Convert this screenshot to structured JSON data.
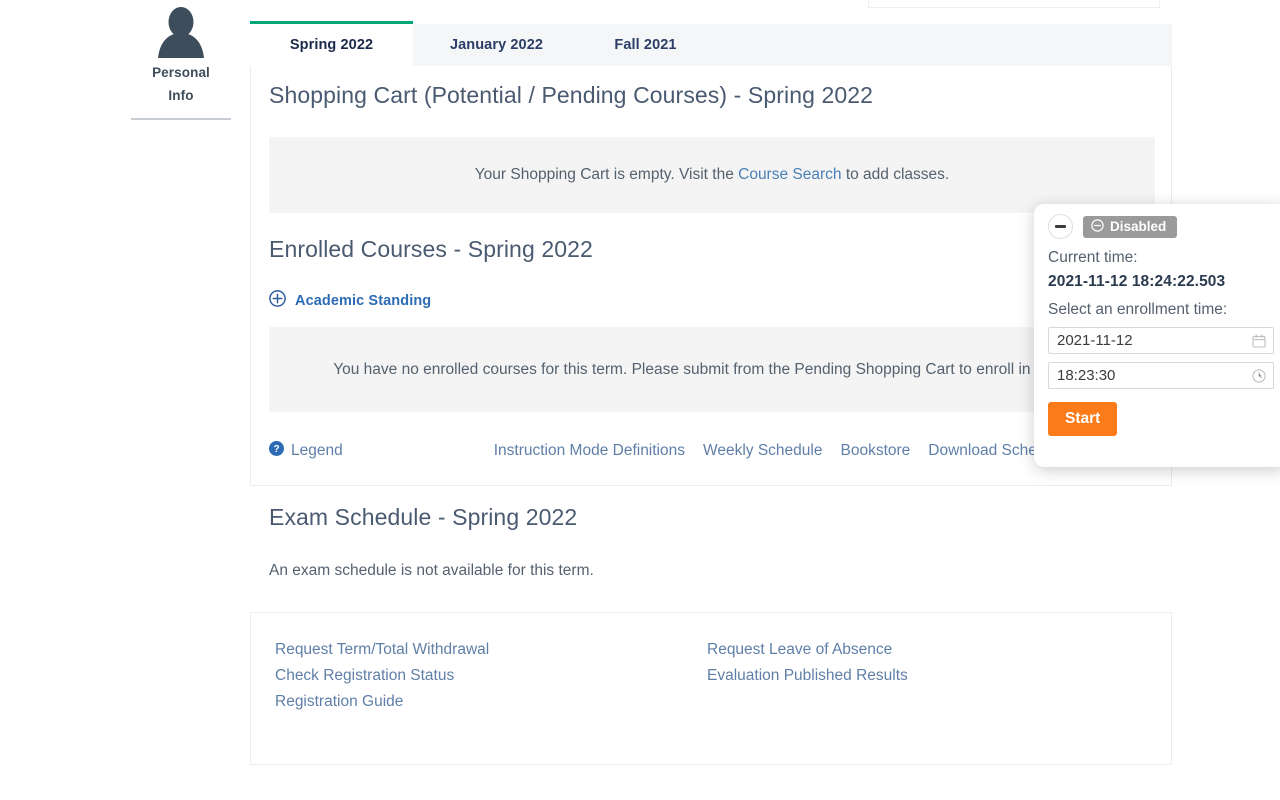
{
  "sidebar": {
    "items": [
      {
        "label_line1": "Personal",
        "label_line2": "Info",
        "icon": "user-avatar-icon"
      }
    ]
  },
  "tabs": [
    {
      "label": "Spring 2022",
      "active": true
    },
    {
      "label": "January 2022",
      "active": false
    },
    {
      "label": "Fall 2021",
      "active": false
    }
  ],
  "main": {
    "cart": {
      "title": "Shopping Cart (Potential / Pending Courses) - Spring 2022",
      "message_before": "Your Shopping Cart is empty. Visit the ",
      "message_link": "Course Search",
      "message_after": " to add classes."
    },
    "enrolled": {
      "title": "Enrolled Courses - Spring 2022",
      "academic_standing_label": "Academic Standing",
      "academic_standing_icon": "plus-circle-icon",
      "message": "You have no enrolled courses for this term. Please submit from the Pending Shopping Cart to enroll in classes."
    },
    "legend": {
      "icon": "question-circle-icon",
      "label": "Legend",
      "links": [
        "Instruction Mode Definitions",
        "Weekly Schedule",
        "Bookstore",
        "Download Schedule"
      ]
    },
    "exam": {
      "title": "Exam Schedule - Spring 2022",
      "message": "An exam schedule is not available for this term."
    }
  },
  "footer_links": {
    "column1": [
      "Request Term/Total Withdrawal",
      "Check Registration Status",
      "Registration Guide"
    ],
    "column2": [
      "Request Leave of Absence",
      "Evaluation Published Results"
    ]
  },
  "enrollment_panel": {
    "minimize_icon": "minimize-icon",
    "status_icon": "disabled-circle-icon",
    "status_label": "Disabled",
    "current_time_label": "Current time:",
    "current_time_value": "2021-11-12 18:24:22.503",
    "select_time_label": "Select an enrollment time:",
    "date_value": "2021-11-12",
    "date_icon": "calendar-icon",
    "time_value": "18:23:30",
    "time_icon": "clock-icon",
    "start_label": "Start"
  },
  "colors": {
    "accent_green": "#00A878",
    "link_blue": "#5F7FA8",
    "heading_slate": "#4A5A70",
    "start_orange": "#FB7A19",
    "badge_gray": "#9A9A9A"
  }
}
